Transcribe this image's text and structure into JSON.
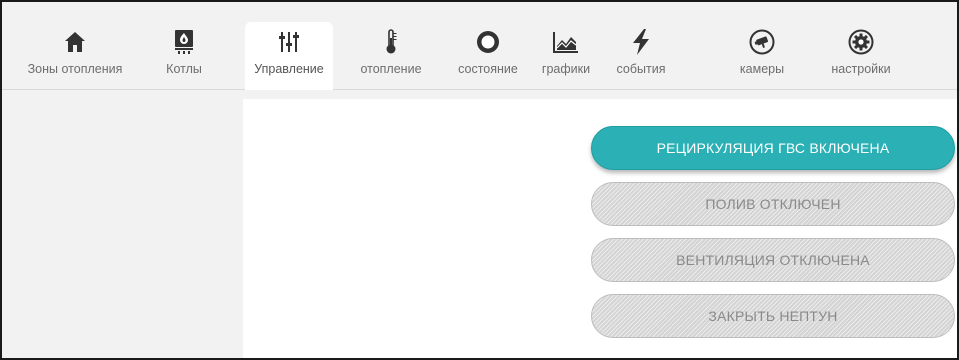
{
  "nav": {
    "items": [
      {
        "label": "Зоны отопления",
        "icon": "home-icon"
      },
      {
        "label": "Котлы",
        "icon": "boiler-icon"
      },
      {
        "label": "Управление",
        "icon": "sliders-icon",
        "active": true
      },
      {
        "label": "отопление",
        "icon": "thermometer-icon"
      },
      {
        "label": "состояние",
        "icon": "circle-status-icon"
      },
      {
        "label": "графики",
        "icon": "chart-icon"
      },
      {
        "label": "события",
        "icon": "lightning-icon"
      },
      {
        "label": "камеры",
        "icon": "camera-icon"
      },
      {
        "label": "настройки",
        "icon": "gear-icon"
      }
    ]
  },
  "controls": {
    "buttons": [
      {
        "label": "РЕЦИРКУЛЯЦИЯ ГВС ВКЛЮЧЕНА",
        "state": "on"
      },
      {
        "label": "ПОЛИВ ОТКЛЮЧЕН",
        "state": "off"
      },
      {
        "label": "ВЕНТИЛЯЦИЯ ОТКЛЮЧЕНА",
        "state": "off"
      },
      {
        "label": "ЗАКРЫТЬ НЕПТУН",
        "state": "off"
      }
    ]
  },
  "colors": {
    "accent": "#2ab0b5",
    "icon": "#333333",
    "nav_text": "#6d6d6d",
    "disabled": "#d4d4d4"
  }
}
